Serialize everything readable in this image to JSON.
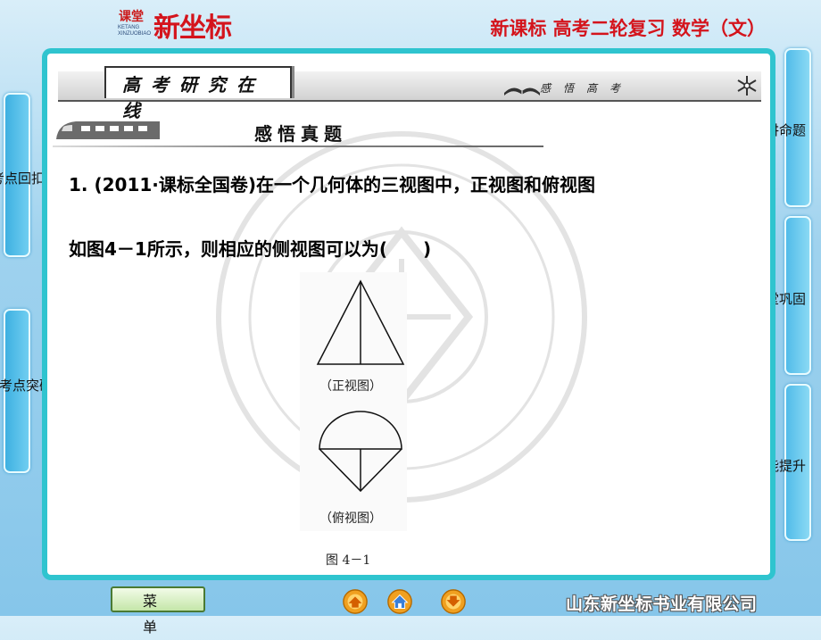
{
  "header": {
    "logo_small": "课堂",
    "logo_sub_1": "KETANG",
    "logo_sub_2": "XINZUOBIAO",
    "logo_big": "新坐标",
    "course_title": "新课标  高考二轮复习  数学（文）"
  },
  "left_tabs": [
    {
      "label": "考点回扣"
    },
    {
      "label": "题考点突破"
    }
  ],
  "right_tabs": [
    {
      "label": "本讲命题"
    },
    {
      "label": "课堂巩固"
    },
    {
      "label": "知能提升"
    }
  ],
  "banner": {
    "title": "高考研究在线",
    "subtitle": "感悟高考"
  },
  "section": {
    "title": "感悟真题"
  },
  "question": {
    "line1": "1.  (2011·课标全国卷)在一个几何体的三视图中，正视图和俯视图",
    "line2": "如图4－1所示，则相应的侧视图可以为(　　)"
  },
  "figure": {
    "front_caption": "（正视图）",
    "top_caption": "（俯视图）",
    "figure_label": "图 4－1"
  },
  "bottom": {
    "menu_label": "菜单",
    "company": "山东新坐标书业有限公司"
  },
  "colors": {
    "panel_border": "#2fc4cf",
    "title_red": "#d4141c",
    "tab_blue": "#3aaee0"
  }
}
